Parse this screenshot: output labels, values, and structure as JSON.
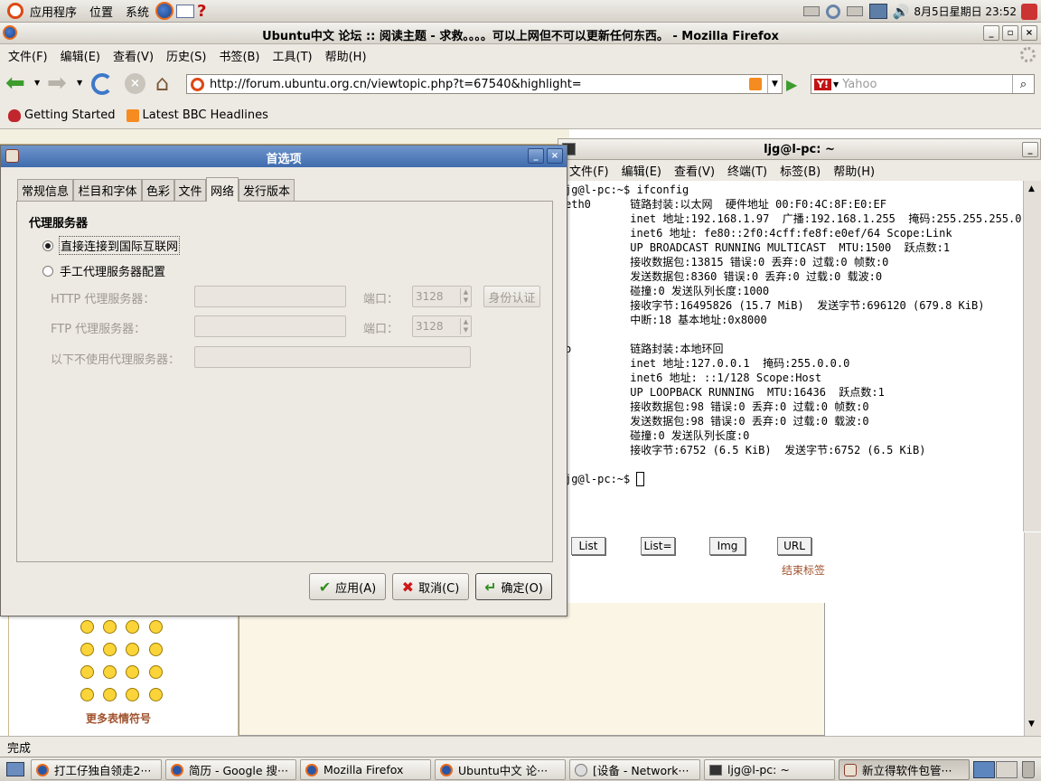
{
  "top_panel": {
    "menus": [
      "应用程序",
      "位置",
      "系统"
    ],
    "datetime": "8月5日星期日 23:52"
  },
  "firefox": {
    "title": "Ubuntu中文 论坛 :: 阅读主题 - 求救。。。。可以上网但不可以更新任何东西。 - Mozilla Firefox",
    "menus": [
      "文件(F)",
      "编辑(E)",
      "查看(V)",
      "历史(S)",
      "书签(B)",
      "工具(T)",
      "帮助(H)"
    ],
    "url": "http://forum.ubuntu.org.cn/viewtopic.php?t=67540&highlight=",
    "search_placeholder": "Yahoo",
    "bookmarks": [
      "Getting Started",
      "Latest BBC Headlines"
    ],
    "status": "完成"
  },
  "page": {
    "tag_buttons": [
      "List",
      "List=",
      "Img",
      "URL"
    ],
    "close_tags": "结束标签",
    "more_smilies": "更多表情符号"
  },
  "terminal": {
    "title": "ljg@l-pc: ~",
    "menus": [
      "文件(F)",
      "编辑(E)",
      "查看(V)",
      "终端(T)",
      "标签(B)",
      "帮助(H)"
    ],
    "lines": [
      "jg@l-pc:~$ ifconfig",
      "eth0      链路封装:以太网  硬件地址 00:F0:4C:8F:E0:EF",
      "          inet 地址:192.168.1.97  广播:192.168.1.255  掩码:255.255.255.0",
      "          inet6 地址: fe80::2f0:4cff:fe8f:e0ef/64 Scope:Link",
      "          UP BROADCAST RUNNING MULTICAST  MTU:1500  跃点数:1",
      "          接收数据包:13815 错误:0 丢弃:0 过载:0 帧数:0",
      "          发送数据包:8360 错误:0 丢弃:0 过载:0 载波:0",
      "          碰撞:0 发送队列长度:1000",
      "          接收字节:16495826 (15.7 MiB)  发送字节:696120 (679.8 KiB)",
      "          中断:18 基本地址:0x8000",
      "",
      "o         链路封装:本地环回",
      "          inet 地址:127.0.0.1  掩码:255.0.0.0",
      "          inet6 地址: ::1/128 Scope:Host",
      "          UP LOOPBACK RUNNING  MTU:16436  跃点数:1",
      "          接收数据包:98 错误:0 丢弃:0 过载:0 帧数:0",
      "          发送数据包:98 错误:0 丢弃:0 过载:0 载波:0",
      "          碰撞:0 发送队列长度:0",
      "          接收字节:6752 (6.5 KiB)  发送字节:6752 (6.5 KiB)",
      "",
      "jg@l-pc:~$ "
    ]
  },
  "dialog": {
    "title": "首选项",
    "tabs": [
      "常规信息",
      "栏目和字体",
      "色彩",
      "文件",
      "网络",
      "发行版本"
    ],
    "section": "代理服务器",
    "radio_direct": "直接连接到国际互联网",
    "radio_manual": "手工代理服务器配置",
    "http_label": "HTTP 代理服务器：",
    "ftp_label": "FTP 代理服务器：",
    "noproxy_label": "以下不使用代理服务器：",
    "port_label": "端口：",
    "http_port": "3128",
    "ftp_port": "3128",
    "auth_button": "身份认证",
    "apply": "应用(A)",
    "cancel": "取消(C)",
    "ok": "确定(O)"
  },
  "taskbar": [
    "打工仔独自领走2···",
    "简历 - Google 搜···",
    "Mozilla Firefox",
    "Ubuntu中文 论···",
    "[设备 - Network···",
    "ljg@l-pc: ~",
    "新立得软件包管···"
  ]
}
